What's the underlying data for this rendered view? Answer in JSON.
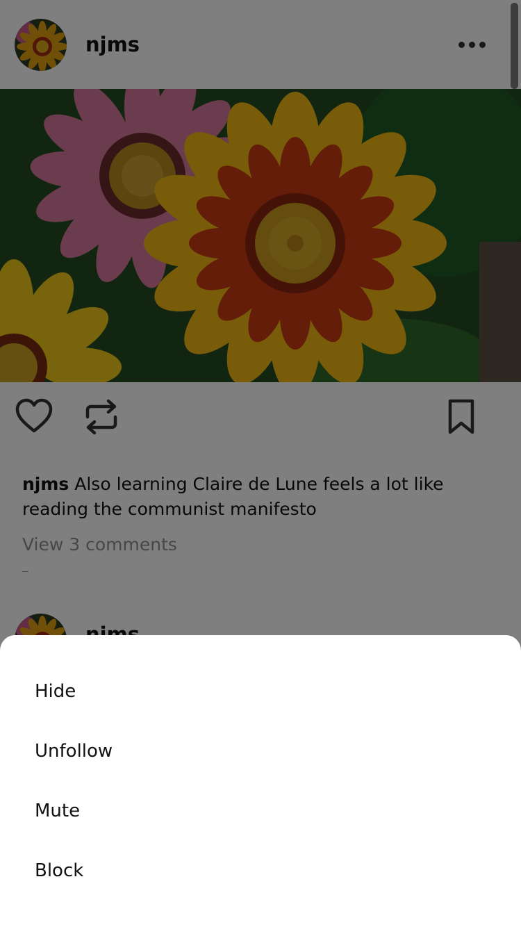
{
  "post": {
    "username": "njms",
    "caption_username": "njms",
    "caption_text": " Also learning Claire de Lune feels a lot like reading the communist manifesto",
    "view_comments": "View 3 comments"
  },
  "next_post": {
    "username": "njms"
  },
  "actions": {
    "like_icon": "heart-outline-icon",
    "repost_icon": "repost-icon",
    "bookmark_icon": "bookmark-outline-icon",
    "more_icon": "ellipsis-icon"
  },
  "menu": {
    "items": [
      "Hide",
      "Unfollow",
      "Mute",
      "Block"
    ]
  },
  "colors": {
    "overlay": "#000000",
    "sheet_background": "#ffffff",
    "icon": "#333333",
    "muted_text": "#8e8e8e"
  }
}
